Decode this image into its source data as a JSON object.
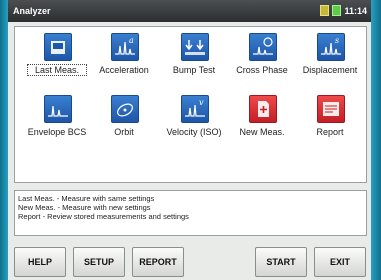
{
  "window": {
    "title": "Analyzer",
    "time": "11:14"
  },
  "measurements": [
    {
      "label": "Last Meas.",
      "icon": "last-measurement-icon",
      "color": "blue",
      "selected": true
    },
    {
      "label": "Acceleration",
      "icon": "acceleration-icon",
      "color": "blue"
    },
    {
      "label": "Bump Test",
      "icon": "bump-test-icon",
      "color": "blue"
    },
    {
      "label": "Cross Phase",
      "icon": "cross-phase-icon",
      "color": "blue"
    },
    {
      "label": "Displacement",
      "icon": "displacement-icon",
      "color": "blue"
    },
    {
      "label": "Envelope BCS",
      "icon": "envelope-icon",
      "color": "blue"
    },
    {
      "label": "Orbit",
      "icon": "orbit-icon",
      "color": "blue"
    },
    {
      "label": "Velocity (ISO)",
      "icon": "velocity-icon",
      "color": "blue"
    },
    {
      "label": "New Meas.",
      "icon": "new-measurement-icon",
      "color": "red"
    },
    {
      "label": "Report",
      "icon": "report-icon",
      "color": "red"
    }
  ],
  "info": [
    "Last Meas. - Measure with same settings",
    "New Meas. - Measure with new settings",
    "Report - Review stored measurements and settings"
  ],
  "buttons": {
    "help": "HELP",
    "setup": "SETUP",
    "report": "REPORT",
    "start": "START",
    "exit": "EXIT"
  }
}
